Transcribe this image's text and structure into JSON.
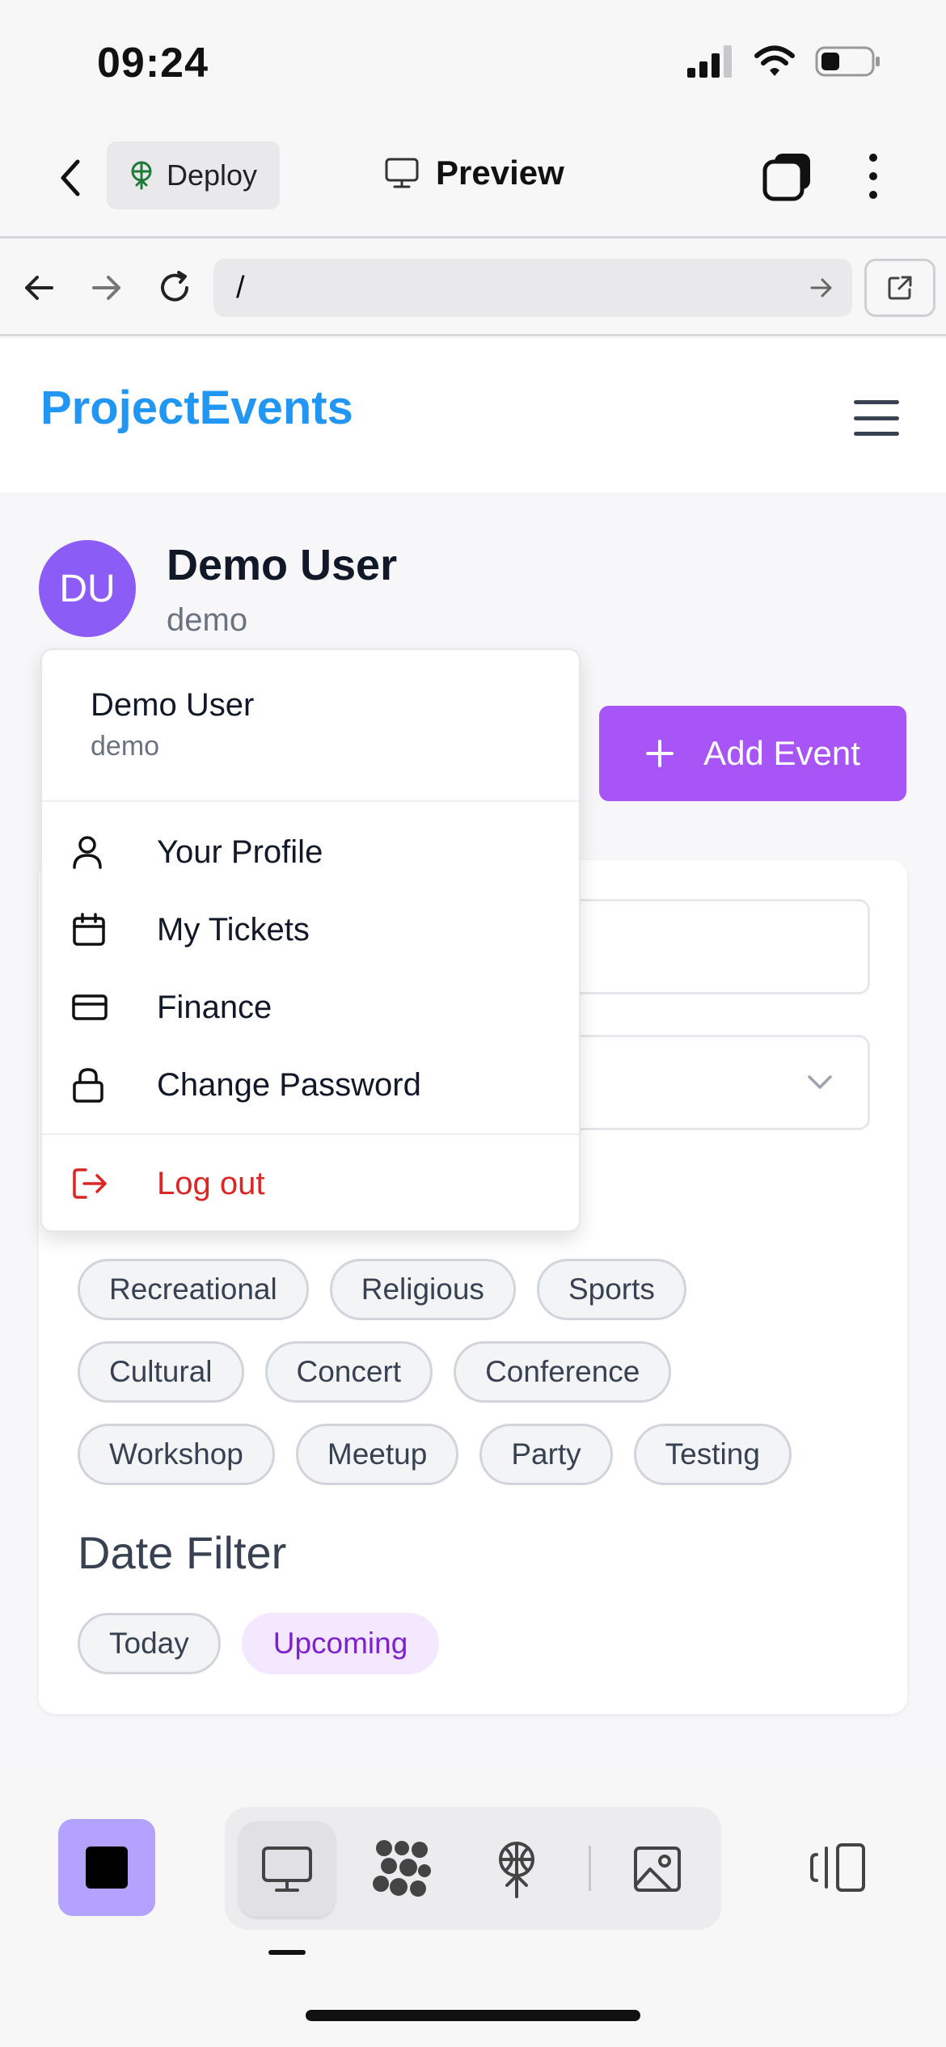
{
  "status_bar": {
    "time": "09:24"
  },
  "app_bar": {
    "deploy_label": "Deploy",
    "title": "Preview"
  },
  "browser": {
    "url": "/"
  },
  "site": {
    "brand": "ProjectEvents"
  },
  "user": {
    "initials": "DU",
    "name": "Demo User",
    "handle": "demo"
  },
  "add_event": {
    "label": "Add Event"
  },
  "dropdown": {
    "name": "Demo User",
    "handle": "demo",
    "items": [
      {
        "label": "Your Profile",
        "icon": "user-icon"
      },
      {
        "label": "My Tickets",
        "icon": "calendar-icon"
      },
      {
        "label": "Finance",
        "icon": "credit-card-icon"
      },
      {
        "label": "Change Password",
        "icon": "lock-icon"
      }
    ],
    "logout": {
      "label": "Log out",
      "icon": "logout-icon"
    }
  },
  "categories": [
    [
      "Recreational",
      "Religious",
      "Sports"
    ],
    [
      "Cultural",
      "Concert",
      "Conference"
    ],
    [
      "Workshop",
      "Meetup",
      "Party",
      "Testing"
    ]
  ],
  "date_filter": {
    "title": "Date Filter",
    "options": [
      {
        "label": "Today",
        "active": false
      },
      {
        "label": "Upcoming",
        "active": true
      }
    ]
  },
  "colors": {
    "brand": "#2196f3",
    "accent": "#a855f7",
    "avatar": "#8b5cf6",
    "danger": "#dc2626",
    "stop": "#b3a3ff"
  },
  "toolbar": {
    "icons": [
      "stop-icon",
      "monitor-icon",
      "bubbles-icon",
      "deploy-icon",
      "image-icon",
      "panel-icon"
    ]
  }
}
